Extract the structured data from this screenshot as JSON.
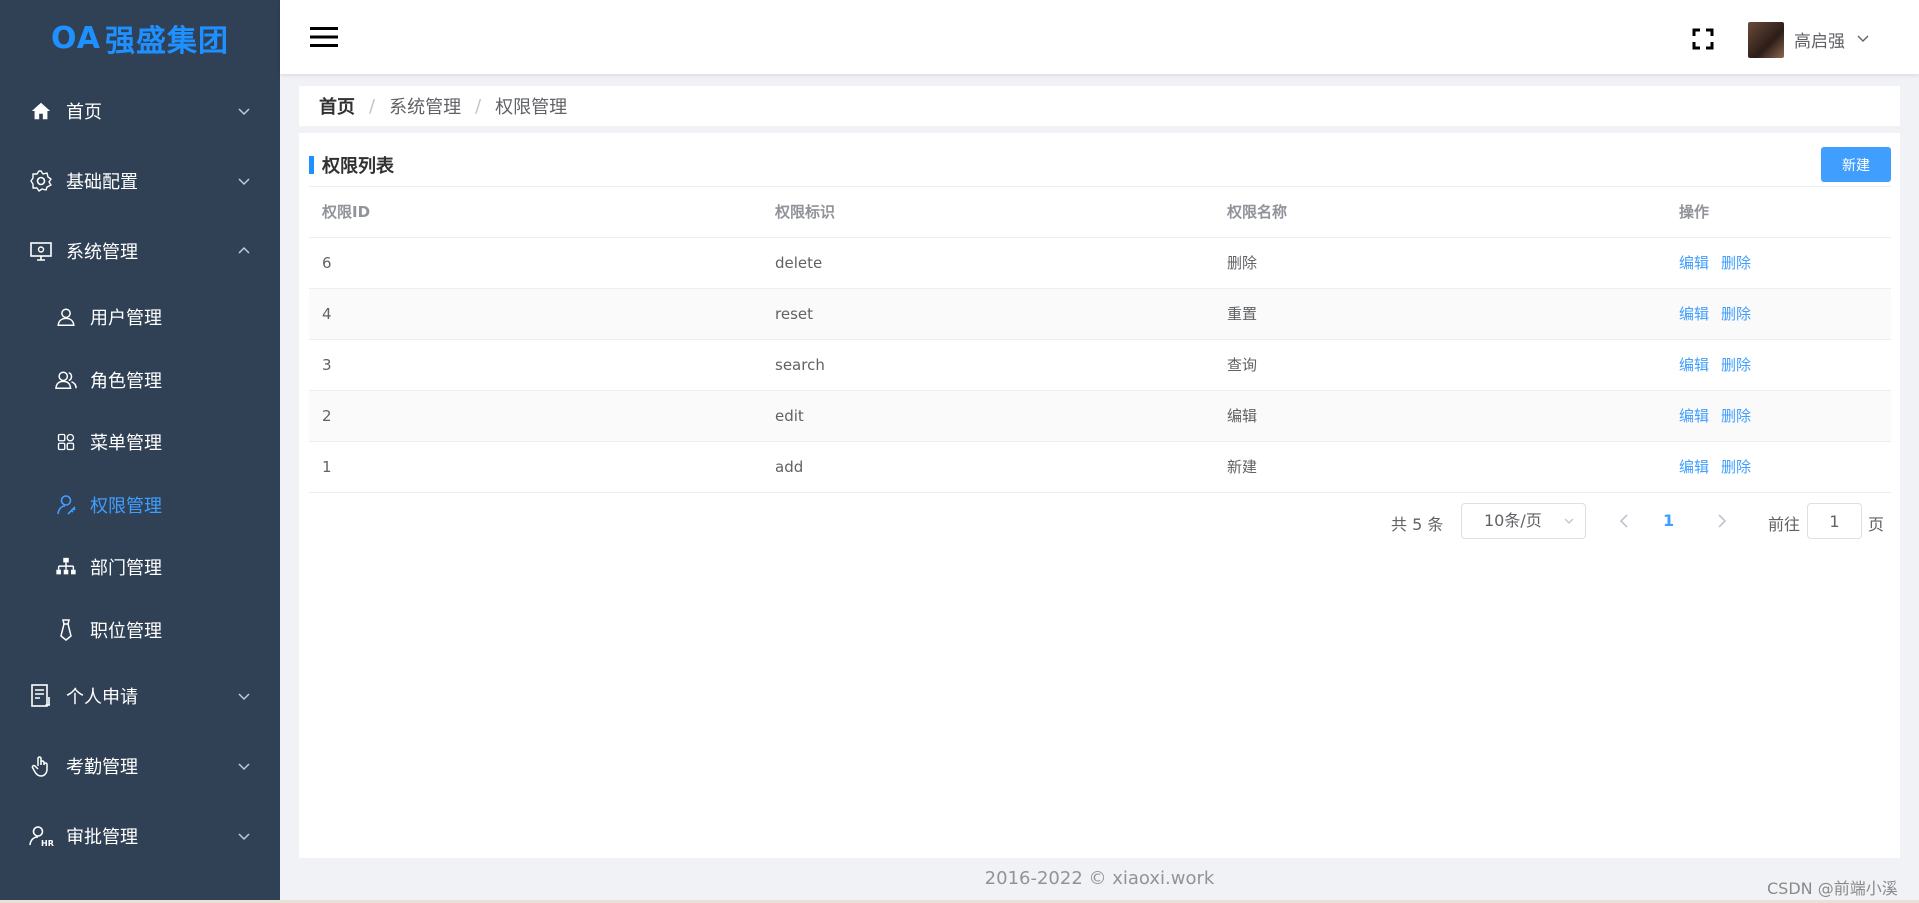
{
  "brand": {
    "logo_mark": "OA",
    "name": "强盛集团"
  },
  "sidebar": {
    "items": [
      {
        "label": "首页",
        "icon": "home-icon",
        "expanded": false
      },
      {
        "label": "基础配置",
        "icon": "gear-icon",
        "expanded": false
      },
      {
        "label": "系统管理",
        "icon": "monitor-icon",
        "expanded": true
      },
      {
        "label": "个人申请",
        "icon": "document-icon",
        "expanded": false
      },
      {
        "label": "考勤管理",
        "icon": "hand-icon",
        "expanded": false
      },
      {
        "label": "审批管理",
        "icon": "user-hr-icon",
        "expanded": false
      }
    ],
    "sub_items": [
      {
        "label": "用户管理",
        "icon": "user-icon"
      },
      {
        "label": "角色管理",
        "icon": "users-icon"
      },
      {
        "label": "菜单管理",
        "icon": "grid-icon"
      },
      {
        "label": "权限管理",
        "icon": "key-user-icon",
        "active": true
      },
      {
        "label": "部门管理",
        "icon": "org-chart-icon"
      },
      {
        "label": "职位管理",
        "icon": "tie-icon"
      }
    ]
  },
  "header": {
    "username": "高启强"
  },
  "breadcrumb": {
    "items": [
      "首页",
      "系统管理",
      "权限管理"
    ],
    "separator": "/"
  },
  "card": {
    "title": "权限列表",
    "new_button": "新建"
  },
  "table": {
    "columns": [
      "权限ID",
      "权限标识",
      "权限名称",
      "操作"
    ],
    "rows": [
      {
        "id": "6",
        "key": "delete",
        "name": "删除"
      },
      {
        "id": "4",
        "key": "reset",
        "name": "重置"
      },
      {
        "id": "3",
        "key": "search",
        "name": "查询"
      },
      {
        "id": "2",
        "key": "edit",
        "name": "编辑"
      },
      {
        "id": "1",
        "key": "add",
        "name": "新建"
      }
    ],
    "actions": {
      "edit": "编辑",
      "delete": "删除"
    }
  },
  "pagination": {
    "total": "共 5 条",
    "page_size": "10条/页",
    "current_page": "1",
    "goto_label": "前往",
    "goto_value": "1",
    "goto_unit": "页"
  },
  "footer": {
    "text": "2016-2022 © xiaoxi.work"
  },
  "watermark": "CSDN @前端小溪",
  "colors": {
    "sidebar_bg": "#304156",
    "accent": "#409eff",
    "brand": "#1e90ff"
  }
}
